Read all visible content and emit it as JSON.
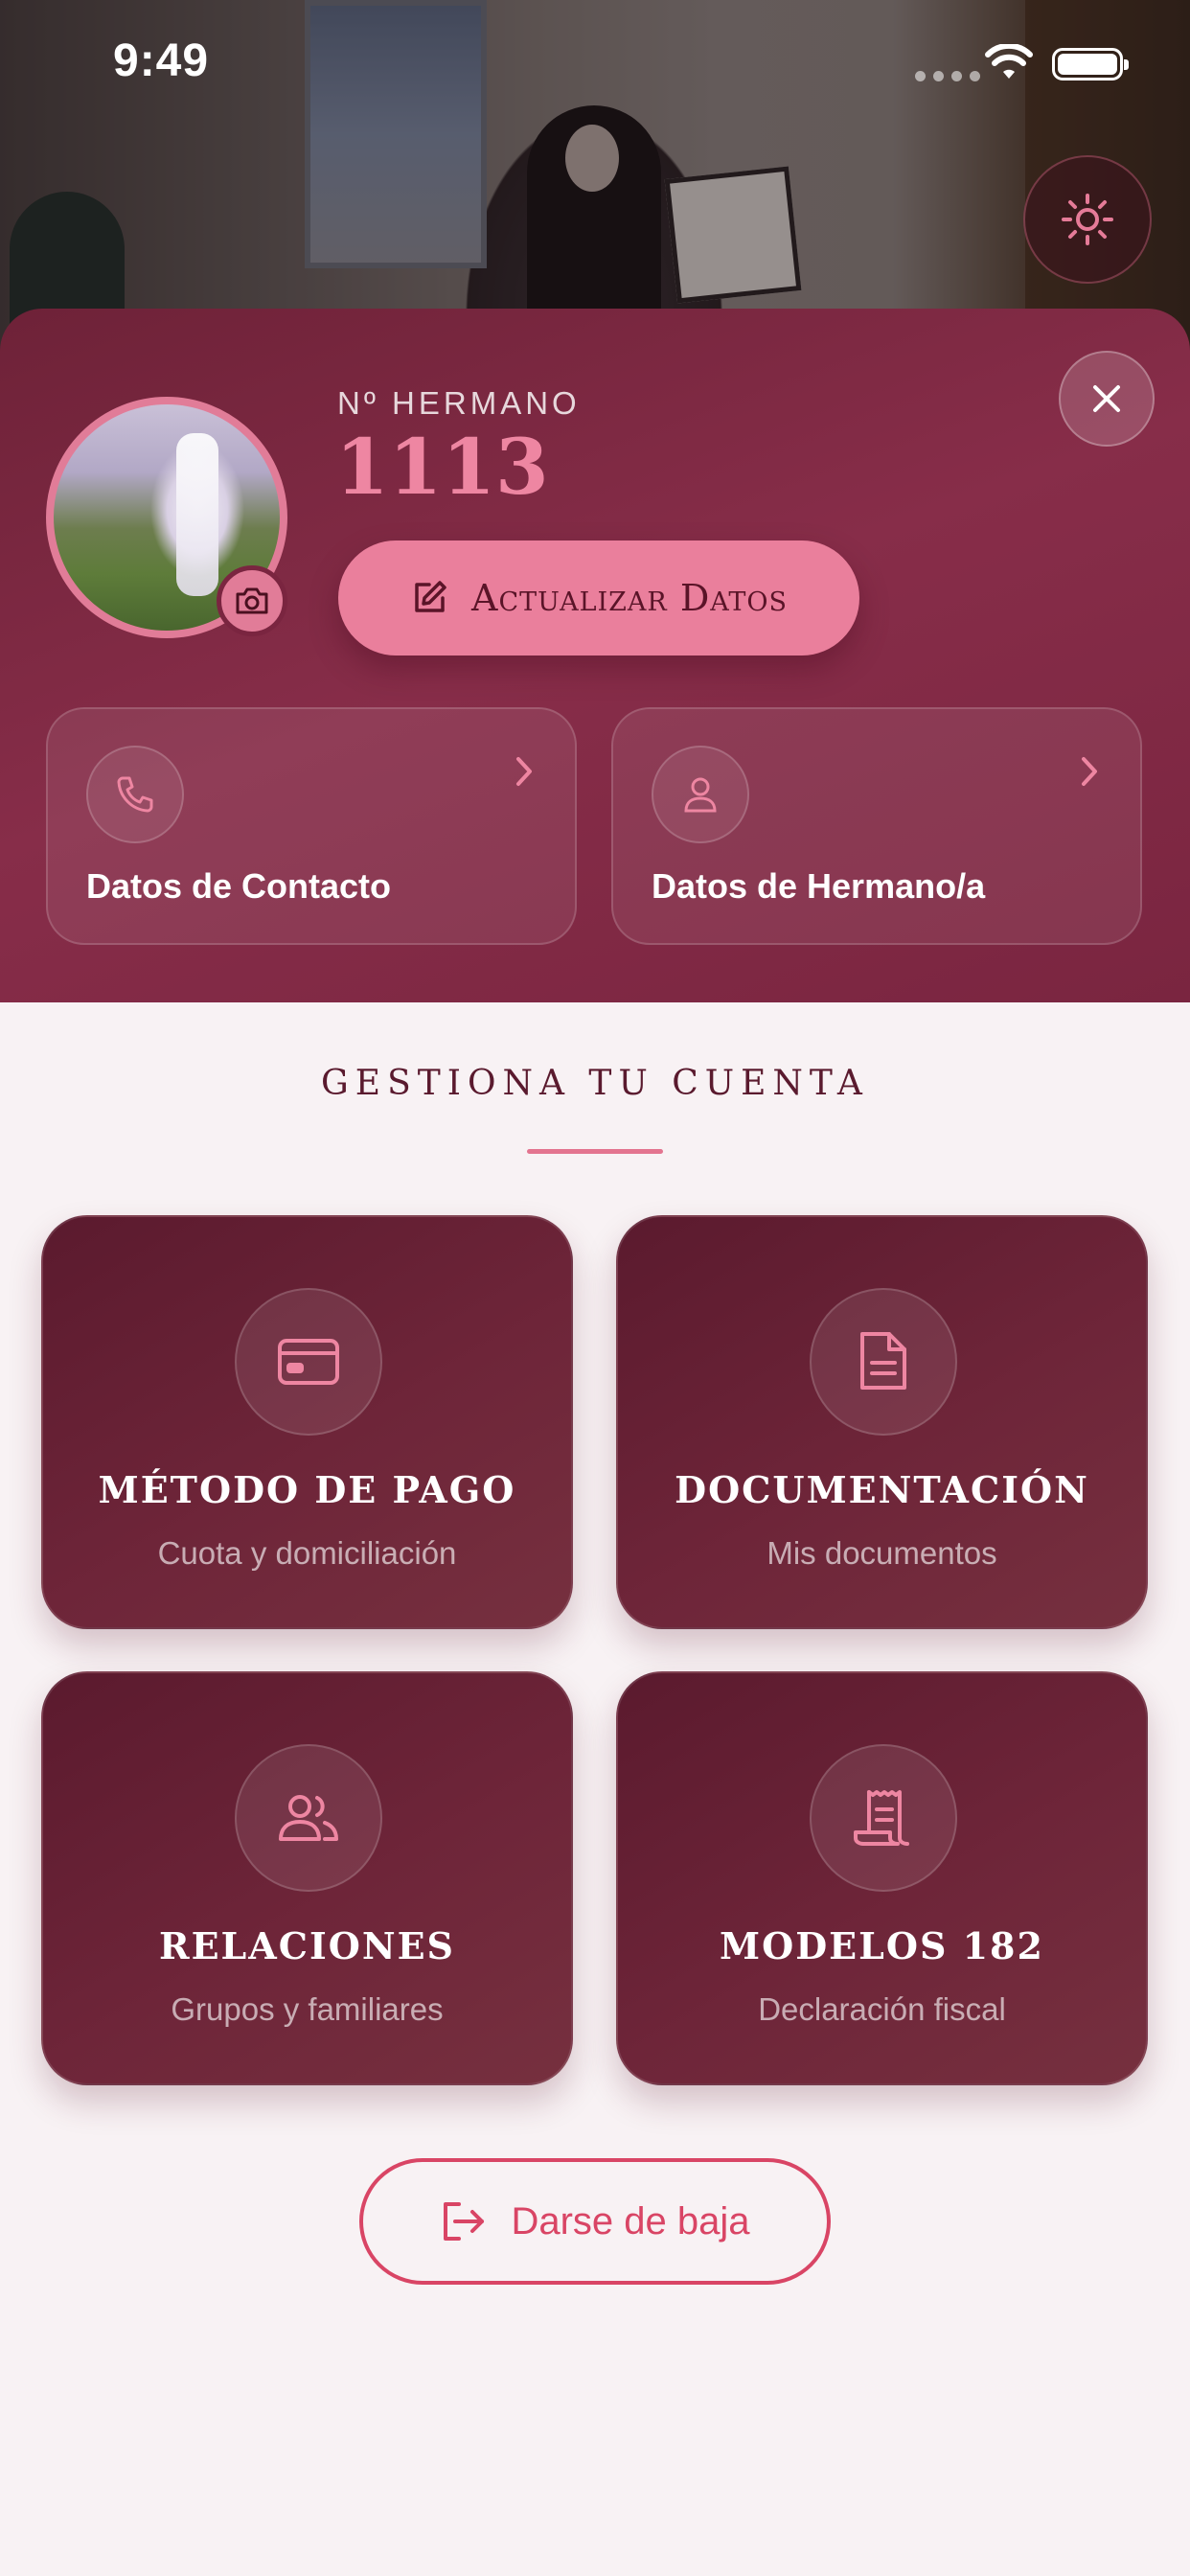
{
  "status_bar": {
    "time": "9:49"
  },
  "profile": {
    "member_label": "Nº HERMANO",
    "member_number": "1113",
    "update_button": "Actualizar Datos"
  },
  "info_cards": [
    {
      "label": "Datos de Contacto",
      "icon": "phone-icon"
    },
    {
      "label": "Datos de Hermano/a",
      "icon": "user-icon"
    }
  ],
  "account": {
    "title": "GESTIONA TU CUENTA",
    "tiles": [
      {
        "title": "MÉTODO DE PAGO",
        "subtitle": "Cuota y domiciliación",
        "icon": "credit-card-icon"
      },
      {
        "title": "DOCUMENTACIÓN",
        "subtitle": "Mis documentos",
        "icon": "document-icon"
      },
      {
        "title": "RELACIONES",
        "subtitle": "Grupos y familiares",
        "icon": "users-icon"
      },
      {
        "title": "MODELOS 182",
        "subtitle": "Declaración fiscal",
        "icon": "receipt-icon"
      }
    ]
  },
  "leave_button": "Darse de baja",
  "colors": {
    "primary": "#7a2540",
    "accent_pink": "#ea7f9c",
    "danger": "#d94565",
    "background": "#f8f2f4"
  }
}
